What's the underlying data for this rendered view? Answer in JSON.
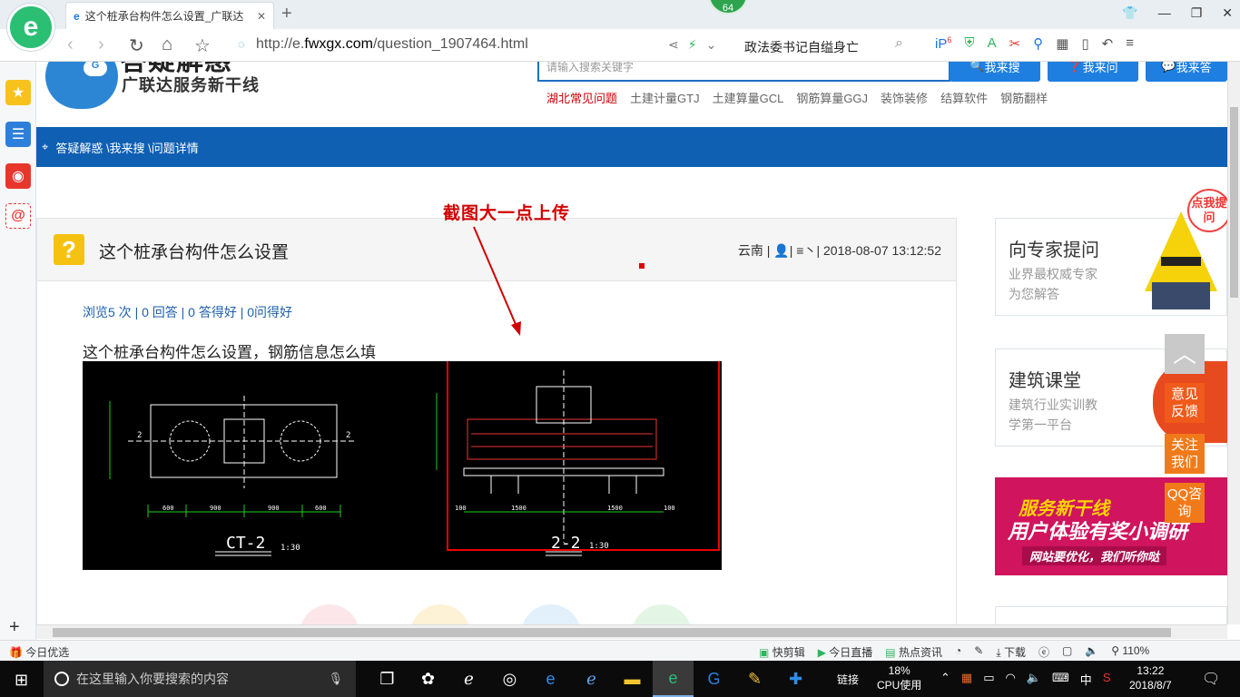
{
  "browser": {
    "tab_title": "这个桩承台构件怎么设置_广联达",
    "badge": "64",
    "url_prefix": "http://e.",
    "url_domain": "fwxgx.com",
    "url_path": "/question_1907464.html",
    "hot_search": "政法委书记自缢身亡",
    "ext_badge": "6"
  },
  "site": {
    "logo_title": "答疑解惑",
    "logo_subtitle": "广联达服务新干线",
    "search_placeholder": "请输入搜索关键字",
    "buttons": [
      "我来搜",
      "我来问",
      "我来答"
    ],
    "quick_links": [
      "湖北常见问题",
      "土建计量GTJ",
      "土建算量GCL",
      "钢筋算量GGJ",
      "装饰装修",
      "结算软件",
      "钢筋翻样"
    ],
    "breadcrumb": "答疑解惑 \\我来搜 \\问题详情"
  },
  "annotation": "截图大一点上传",
  "question": {
    "title": "这个桩承台构件怎么设置",
    "meta": "云南 | 👤| ≡丶| 2018-08-07 13:12:52",
    "stats": "浏览5 次 | 0 回答 | 0 答得好 | 0问得好",
    "body": "这个桩承台构件怎么设置，钢筋信息怎么填"
  },
  "drawing": {
    "plan_label": "CT-2",
    "plan_scale": "1:30",
    "section_label": "2-2",
    "section_scale": "1:30",
    "dims_plan": [
      "600",
      "900",
      "900",
      "600"
    ],
    "dims_section": [
      "100",
      "1500",
      "1500",
      "100"
    ]
  },
  "right": {
    "expert_title": "向专家提问",
    "expert_sub": [
      "业界最权威专家",
      "为您解答"
    ],
    "school_title": "建筑课堂",
    "school_sub": [
      "建筑行业实训教",
      "学第一平台"
    ],
    "banner_l1": "服务新干线",
    "banner_l2": "用户体验有奖小调研",
    "banner_l3": "网站要优化，我们听你哒",
    "bubble": "点我提问"
  },
  "float": {
    "totop": "︿",
    "feedback": "意见反馈",
    "follow": "关注我们",
    "qq": "QQ咨询"
  },
  "statusbar": {
    "left": "今日优选",
    "right": [
      "快剪辑",
      "今日直播",
      "热点资讯",
      "下载",
      "110%"
    ]
  },
  "taskbar": {
    "search_placeholder": "在这里输入你要搜索的内容",
    "link_label": "链接",
    "cpu_pct": "18%",
    "cpu_label": "CPU使用",
    "ime": "中",
    "time": "13:22",
    "date": "2018/8/7"
  }
}
